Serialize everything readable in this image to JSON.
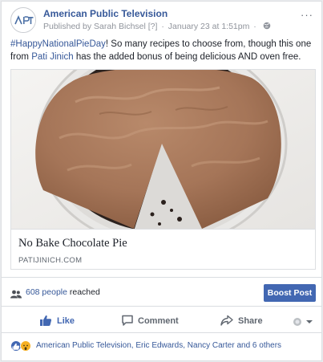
{
  "post": {
    "page_name": "American Public Television",
    "avatar_text": "APT",
    "published_by": "Published by Sarah Bichsel",
    "published_by_marker": "[?]",
    "separator": "·",
    "timestamp": "January 23 at 1:51pm",
    "separator2": "·",
    "privacy_icon": "globe-icon",
    "more_label": "···",
    "text_hashtag": "#HappyNationalPieDay",
    "text_part1": "! So many recipes to choose from, though this one from ",
    "text_mention": "Pati Jinich",
    "text_part2": " has the added bonus of being delicious AND oven free."
  },
  "attachment": {
    "title": "No Bake Chocolate Pie",
    "domain": "PATIJINICH.COM",
    "image_subject": "chocolate pie with a slice removed"
  },
  "reach": {
    "icon": "people-icon",
    "count": "608 people",
    "suffix": " reached",
    "boost_label": "Boost Post"
  },
  "actions": {
    "like_label": "Like",
    "comment_label": "Comment",
    "share_label": "Share"
  },
  "reactions": {
    "icons": [
      "like-reaction-icon",
      "wow-reaction-icon"
    ],
    "summary": "American Public Television, Eric Edwards, Nancy Carter and 6 others"
  },
  "colors": {
    "link": "#365899",
    "boost_button": "#4267b2",
    "like_active": "#4267b2",
    "meta_gray": "#90949c"
  }
}
